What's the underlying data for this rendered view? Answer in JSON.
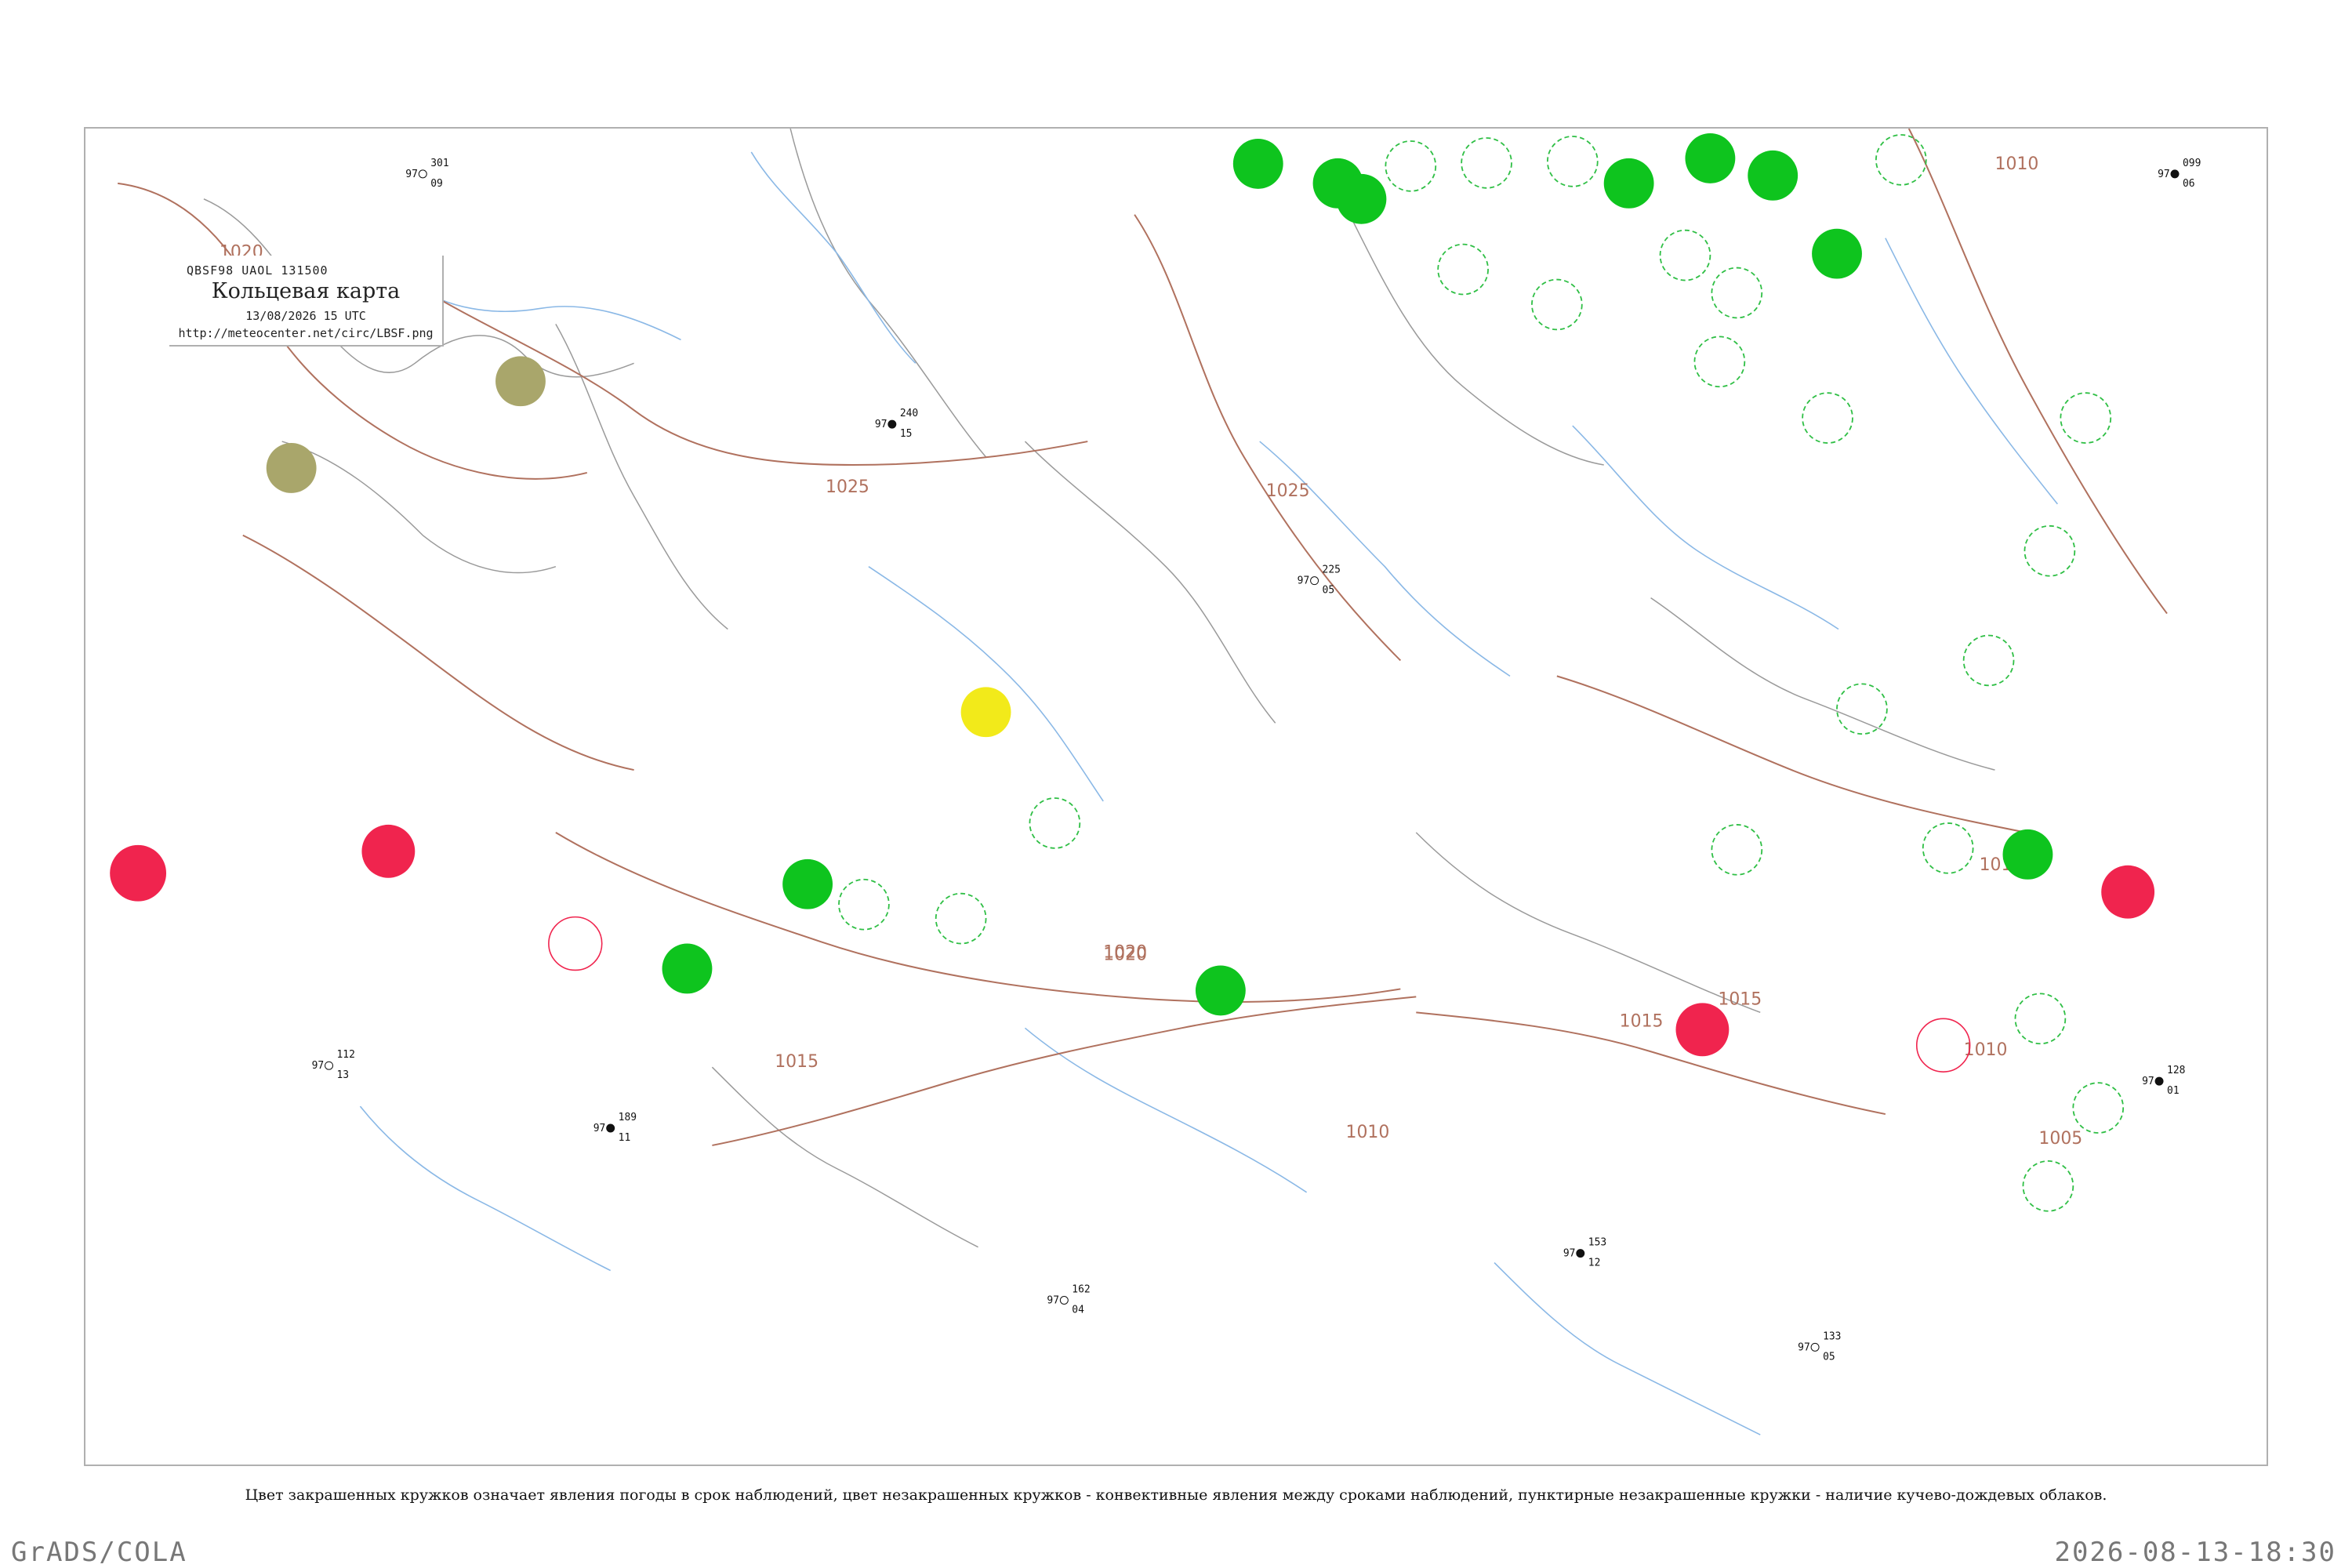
{
  "header": {
    "code": "QBSF98  UAOL  131500",
    "title": "Кольцевая карта",
    "datetime": "13/08/2026 15 UTC",
    "url": "http://meteocenter.net/circ/LBSF.png"
  },
  "isobar_labels": [
    "1020",
    "1025",
    "1015",
    "1025",
    "1020",
    "1015",
    "1010",
    "1015",
    "1015",
    "1010",
    "1005",
    "1010",
    "1020"
  ],
  "caption": "Цвет закрашенных кружков означает явления погоды в срок наблюдений, цвет незакрашенных кружков - конвективные явления между сроками наблюдений, пунктирные незакрашенные кружки - наличие кучево-дождевых облаков.",
  "footer": {
    "left": "GrADS/COLA",
    "right": "2026-08-13-18:30"
  },
  "colors": {
    "isobar": "#b0715e",
    "water": "#8ab8e6",
    "border": "#9a9a9a",
    "precip_rain": "#0ec41e",
    "thunder": "#f0244e",
    "fog": "#f2ea1a",
    "haze": "#a9a66b",
    "cb_dashed": "#2fbf45"
  },
  "stations_sample": [
    {
      "pressure": "301",
      "temp": "97",
      "dew": "09"
    },
    {
      "pressure": "240",
      "temp": "97",
      "dew": "15"
    },
    {
      "pressure": "225",
      "temp": "97",
      "dew": "05"
    },
    {
      "pressure": "189",
      "temp": "97",
      "dew": "11"
    },
    {
      "pressure": "162",
      "temp": "97",
      "dew": "04"
    },
    {
      "pressure": "153",
      "temp": "97",
      "dew": "12"
    },
    {
      "pressure": "133",
      "temp": "97",
      "dew": "05"
    },
    {
      "pressure": "128",
      "temp": "97",
      "dew": "01"
    },
    {
      "pressure": "112",
      "temp": "97",
      "dew": "13"
    },
    {
      "pressure": "099",
      "temp": "97",
      "dew": "06"
    }
  ]
}
